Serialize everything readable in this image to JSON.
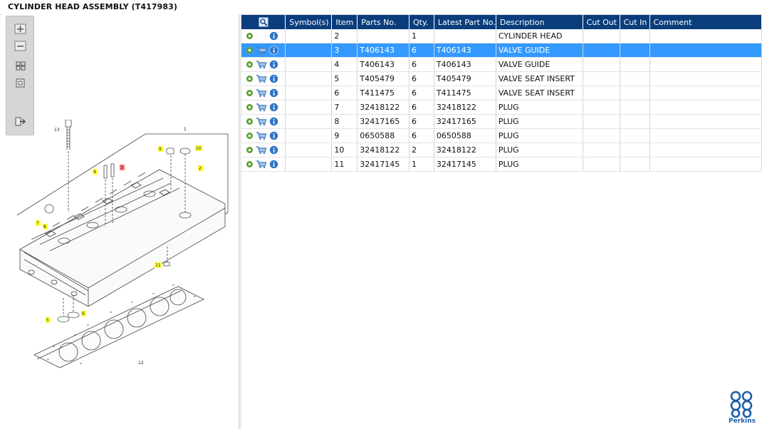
{
  "window": {
    "title": "CYLINDER HEAD ASSEMBLY (T417983)"
  },
  "toolbar": {
    "buttons": [
      {
        "name": "zoom-in-icon"
      },
      {
        "name": "zoom-out-icon"
      },
      {
        "name": "fit-icon"
      },
      {
        "name": "actual-size-icon"
      },
      {
        "name": "export-icon"
      }
    ]
  },
  "diagram": {
    "callouts": [
      "13",
      "1",
      "9",
      "10",
      "4",
      "3",
      "2",
      "7",
      "8",
      "11",
      "5",
      "6",
      "12"
    ]
  },
  "table": {
    "headers": {
      "symbols": "Symbol(s)",
      "item": "Item",
      "parts_no": "Parts No.",
      "qty": "Qty.",
      "latest_part_no": "Latest Part No.",
      "description": "Description",
      "cut_out": "Cut Out",
      "cut_in": "Cut In",
      "comment": "Comment"
    },
    "rows": [
      {
        "item": "2",
        "parts_no": "",
        "qty": "1",
        "latest": "",
        "description": "CYLINDER HEAD",
        "cart": false,
        "selected": false
      },
      {
        "item": "3",
        "parts_no": "T406143",
        "qty": "6",
        "latest": "T406143",
        "description": "VALVE GUIDE",
        "cart": true,
        "selected": true
      },
      {
        "item": "4",
        "parts_no": "T406143",
        "qty": "6",
        "latest": "T406143",
        "description": "VALVE GUIDE",
        "cart": true,
        "selected": false
      },
      {
        "item": "5",
        "parts_no": "T405479",
        "qty": "6",
        "latest": "T405479",
        "description": "VALVE SEAT INSERT",
        "cart": true,
        "selected": false
      },
      {
        "item": "6",
        "parts_no": "T411475",
        "qty": "6",
        "latest": "T411475",
        "description": "VALVE SEAT INSERT",
        "cart": true,
        "selected": false
      },
      {
        "item": "7",
        "parts_no": "32418122",
        "qty": "6",
        "latest": "32418122",
        "description": "PLUG",
        "cart": true,
        "selected": false
      },
      {
        "item": "8",
        "parts_no": "32417165",
        "qty": "6",
        "latest": "32417165",
        "description": "PLUG",
        "cart": true,
        "selected": false
      },
      {
        "item": "9",
        "parts_no": "0650588",
        "qty": "6",
        "latest": "0650588",
        "description": "PLUG",
        "cart": true,
        "selected": false
      },
      {
        "item": "10",
        "parts_no": "32418122",
        "qty": "2",
        "latest": "32418122",
        "description": "PLUG",
        "cart": true,
        "selected": false
      },
      {
        "item": "11",
        "parts_no": "32417145",
        "qty": "1",
        "latest": "32417145",
        "description": "PLUG",
        "cart": true,
        "selected": false
      }
    ]
  },
  "brand": {
    "logo_text": "Perkins",
    "color": "#1e5ea8"
  },
  "colors": {
    "header_bg": "#0a3d7c",
    "selected_bg": "#3399ff"
  }
}
